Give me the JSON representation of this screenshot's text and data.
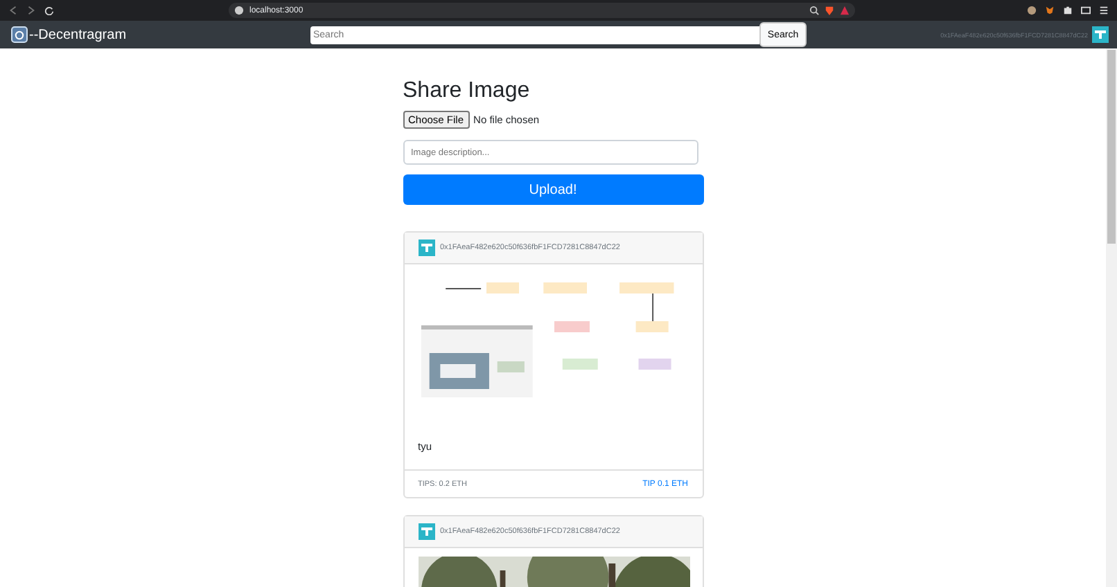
{
  "browser": {
    "url": "localhost:3000"
  },
  "navbar": {
    "brand": "--Decentragram",
    "search": {
      "placeholder": "Search"
    },
    "search_button": "Search",
    "account": "0x1FAeaF482e620c50f636fbF1FCD7281C8847dC22"
  },
  "form": {
    "title": "Share Image",
    "file_button": "Choose File",
    "file_status": "No file chosen",
    "description": {
      "placeholder": "Image description..."
    },
    "submit": "Upload!"
  },
  "posts": [
    {
      "author": "0x1FAeaF482e620c50f636fbF1FCD7281C8847dC22",
      "description": "tyu",
      "tips": "TIPS: 0.2 ETH",
      "tip_link": "TIP 0.1 ETH"
    },
    {
      "author": "0x1FAeaF482e620c50f636fbF1FCD7281C8847dC22"
    }
  ]
}
